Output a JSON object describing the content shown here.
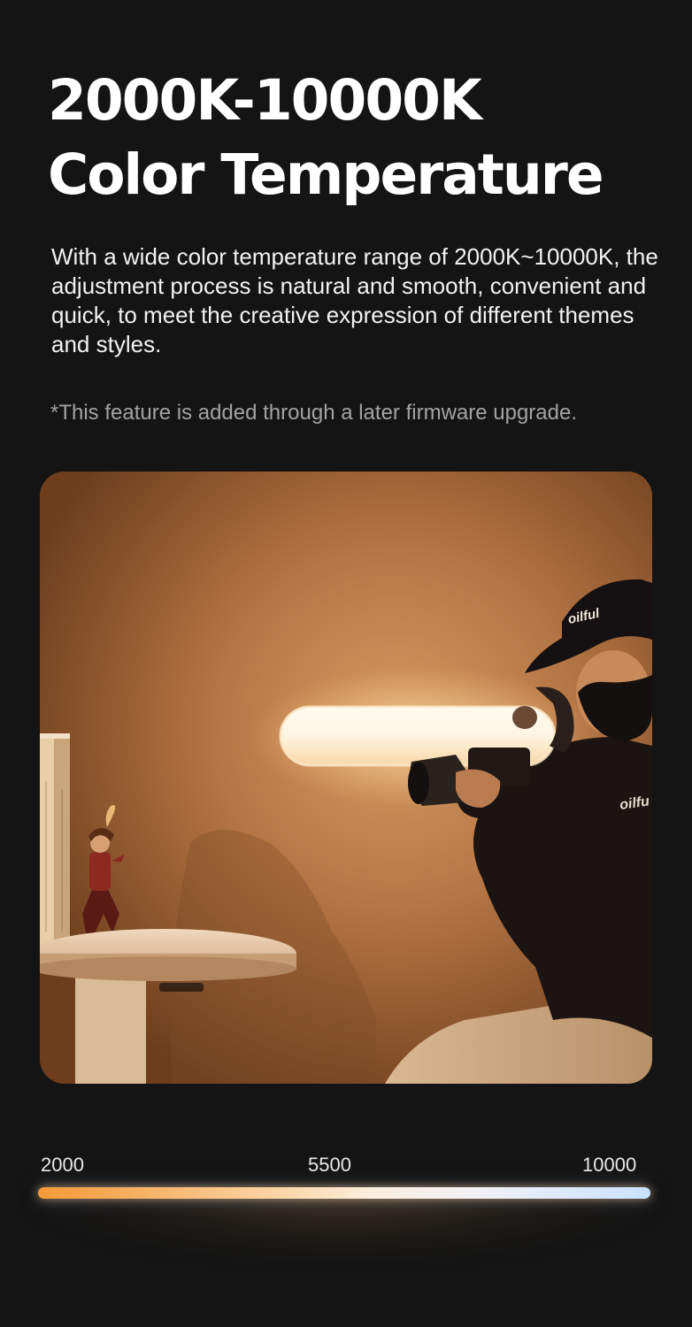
{
  "title": {
    "line1": "2000K-10000K",
    "line2": "Color Temperature"
  },
  "description": "With a wide color temperature range of 2000K~10000K, the adjustment process is natural and smooth, convenient and quick, to meet the creative expression of different themes and styles.",
  "footnote": "*This feature is added through a later firmware upgrade.",
  "photo": {
    "cap_logo": "oilful",
    "sweater_logo": "oilfu"
  },
  "scale": {
    "min": "2000",
    "mid": "5500",
    "max": "10000"
  },
  "colors": {
    "background": "#141414",
    "warm_end": "#f49a36",
    "cool_end": "#c9e1fc"
  }
}
